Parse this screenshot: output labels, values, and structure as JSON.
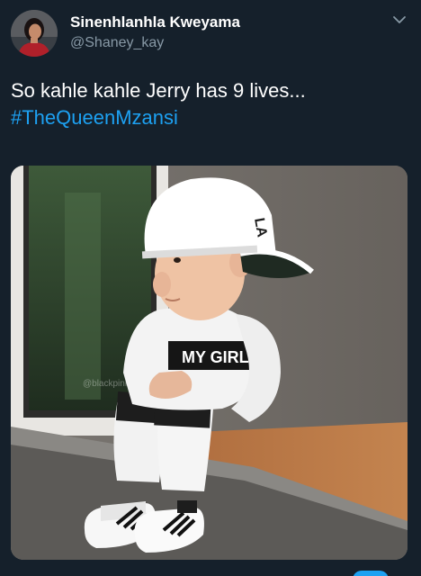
{
  "tweet": {
    "display_name": "Sinenhlanhla Kweyama",
    "handle": "@Shaney_kay",
    "text_line": "So kahle kahle Jerry has 9 lives...",
    "hashtag": "#TheQueenMzansi",
    "icons": {
      "avatar": "avatar-photo",
      "menu": "chevron-down-icon"
    }
  },
  "media": {
    "description_icon": "photo",
    "cap_text": "LA",
    "shirt_text": "MY GIRLS",
    "watermark": "@blackpink"
  },
  "colors": {
    "background": "#15202b",
    "secondary_text": "#8899a6",
    "link": "#1da1f2",
    "primary_text": "#ffffff"
  }
}
